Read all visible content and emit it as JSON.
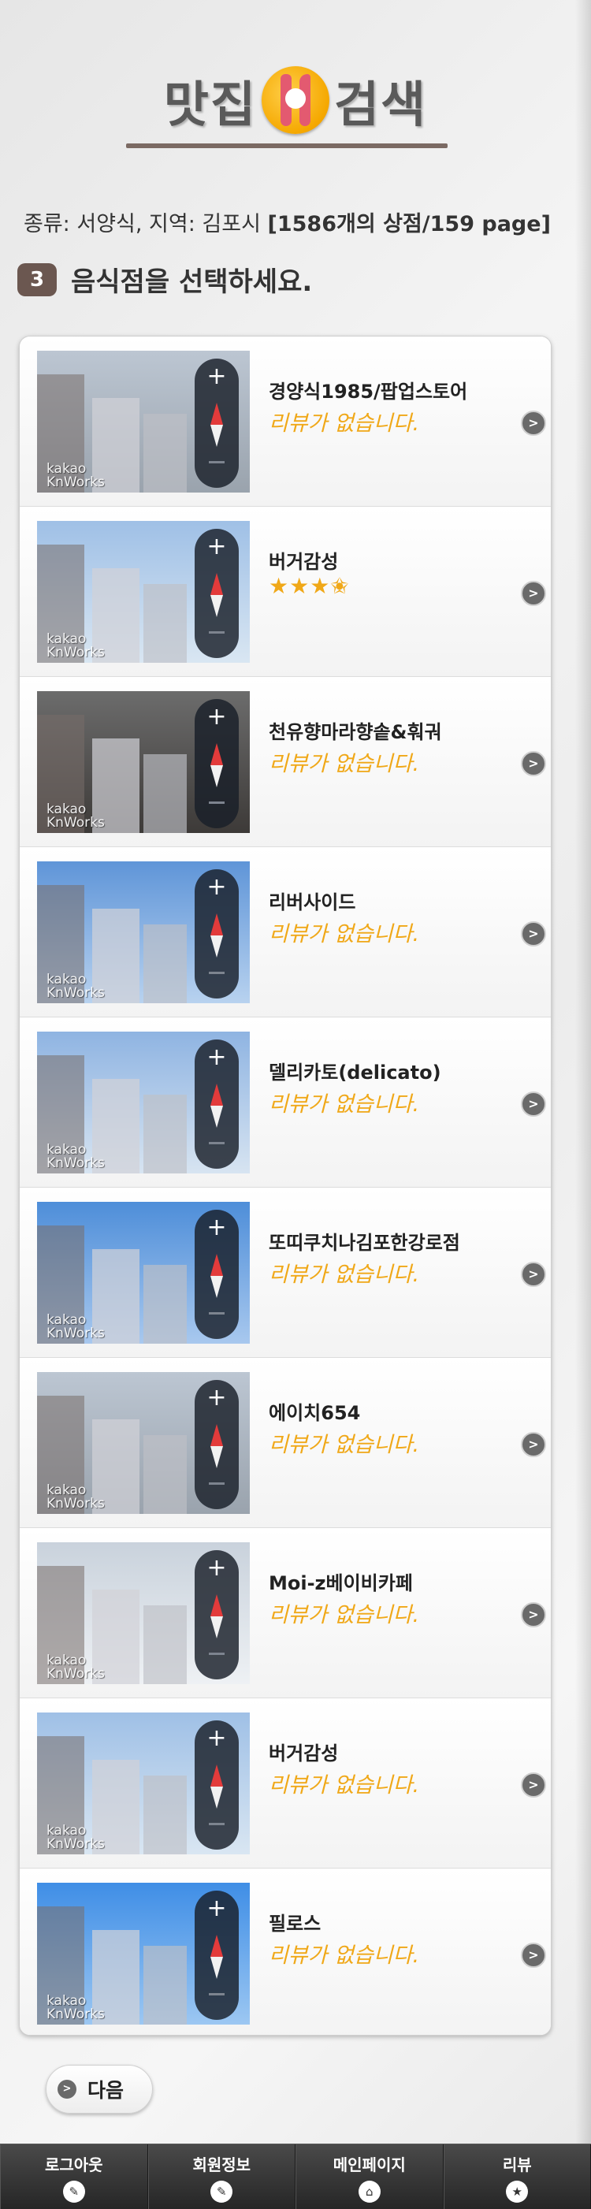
{
  "header": {
    "title_left": "맛집",
    "title_right": "검색",
    "logo_icon": "fork-knife-plate-icon"
  },
  "info": {
    "text": "종류: 서양식, 지역: 김포시 ",
    "count": "[1586개의 상점/159 page]"
  },
  "step": {
    "number": "3",
    "text": "음식점을 선택하세요."
  },
  "thumbnail_watermark": {
    "line1": "kakao",
    "line2": "KnWorks"
  },
  "restaurants": [
    {
      "name": "경양식1985/팝업스토어",
      "review": "리뷰가 없습니다.",
      "stars": ""
    },
    {
      "name": "버거감성",
      "review": "",
      "stars": "★★★✬"
    },
    {
      "name": "천유향마라향솥&훠궈",
      "review": "리뷰가 없습니다.",
      "stars": ""
    },
    {
      "name": "리버사이드",
      "review": "리뷰가 없습니다.",
      "stars": ""
    },
    {
      "name": "델리카토(delicato)",
      "review": "리뷰가 없습니다.",
      "stars": ""
    },
    {
      "name": "또띠쿠치나김포한강로점",
      "review": "리뷰가 없습니다.",
      "stars": ""
    },
    {
      "name": "에이치654",
      "review": "리뷰가 없습니다.",
      "stars": ""
    },
    {
      "name": "Moi-z베이비카페",
      "review": "리뷰가 없습니다.",
      "stars": ""
    },
    {
      "name": "버거감성",
      "review": "리뷰가 없습니다.",
      "stars": ""
    },
    {
      "name": "필로스",
      "review": "리뷰가 없습니다.",
      "stars": ""
    }
  ],
  "map_controls": {
    "plus": "+",
    "compass_icon": "compass-icon"
  },
  "next_button": {
    "label": "다음",
    "icon": "chevron-right-circle-icon"
  },
  "footer": {
    "tabs": [
      {
        "label": "로그아웃",
        "icon": "pencil-icon",
        "glyph": "✎"
      },
      {
        "label": "회원정보",
        "icon": "pencil-icon",
        "glyph": "✎"
      },
      {
        "label": "메인페이지",
        "icon": "home-icon",
        "glyph": "⌂"
      },
      {
        "label": "리뷰",
        "icon": "star-icon",
        "glyph": "★"
      }
    ]
  },
  "colors": {
    "accent_review": "#f0a818",
    "step_badge": "#6b5750",
    "title_underline": "#7b6a63",
    "footer_bg": "#2e2e2e"
  }
}
